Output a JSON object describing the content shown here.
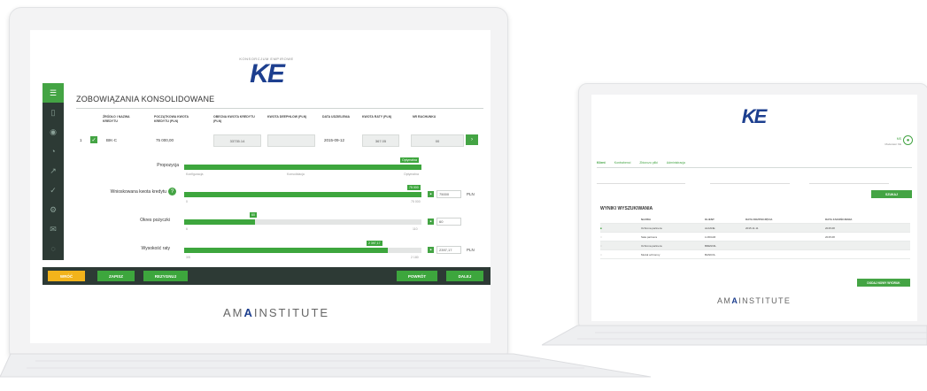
{
  "logo": {
    "text": "KE",
    "subtitle": "KONSORCJUM EMPIROWE"
  },
  "brand_footer": {
    "pre": "AM",
    "mark": "A",
    "post": "INSTITUTE"
  },
  "left_app": {
    "title": "ZOBOWIĄZANIA KONSOLIDOWANE",
    "columns": [
      "ŹRÓDŁO I NAZWA KREDYTU",
      "POCZĄTKOWA KWOTA KREDYTU (PLN)",
      "OBECNA KWOTA KREDYTU (PLN)",
      "KWOTA DEEPHLOW (PLN)",
      "DATA UDZIELENIA",
      "KWOTA RATY (PLN)",
      "NR RACHUNKU"
    ],
    "row": {
      "index": "1",
      "name": "BIK-C",
      "initial": "75 000,00",
      "current": "33735.14",
      "date": "2015-09-12",
      "installment": "367.05",
      "account": "00"
    },
    "sliders": [
      {
        "label": "Propozycja",
        "min": "Konfiguracja",
        "mid": "Konsolidacja",
        "max": "Optymalna",
        "bubble": "Optymalna",
        "value_fraction": 1.0
      },
      {
        "label": "Wnioskowana kwota kredytu",
        "min": "0",
        "max": "75 000",
        "bubble": "75 000",
        "input": "75000",
        "unit": "PLN",
        "value_fraction": 1.0
      },
      {
        "label": "Okres pożyczki",
        "min": "6",
        "max": "110",
        "bubble": "60",
        "input": "60",
        "unit": "",
        "value_fraction": 0.3
      },
      {
        "label": "Wysokość raty",
        "min": "3/5",
        "max": "2 180",
        "bubble": "2 397,17",
        "input": "2397,17",
        "unit": "PLN",
        "value_fraction": 0.86
      }
    ],
    "buttons": {
      "back": "WRÓĆ",
      "save": "ZAPISZ",
      "resign": "REZYGNUJ",
      "recalc": "POWRÓT",
      "next": "DALEJ"
    }
  },
  "right_app": {
    "user": {
      "initials": "MS",
      "name": "Moderator KE"
    },
    "tabs": [
      "Klient",
      "Kontrahenci",
      "Zbiorczo pliki",
      "Administracja"
    ],
    "search_btn": "SZUKAJ",
    "results_title": "WYNIKI WYSZUKIWANIA",
    "columns": [
      "",
      "NAZWA",
      "KLIENT",
      "DATA ROZPOCZĘCIA",
      "DATA ZAKOŃCZENIA"
    ],
    "rows": [
      {
        "name": "Ochrona partnera",
        "client": "ALFANE",
        "start": "2015.11.11",
        "end": "2015.08"
      },
      {
        "name": "Sala partnera",
        "client": "LUDUAR",
        "start": "",
        "end": "2015.08"
      },
      {
        "name": "Ochrona partnera",
        "client": "BRENNIL",
        "start": "",
        "end": ""
      },
      {
        "name": "Moduł ochronny",
        "client": "BANKOL",
        "start": "",
        "end": ""
      }
    ],
    "add_btn": "DODAJ NOWY WYDRUK"
  }
}
